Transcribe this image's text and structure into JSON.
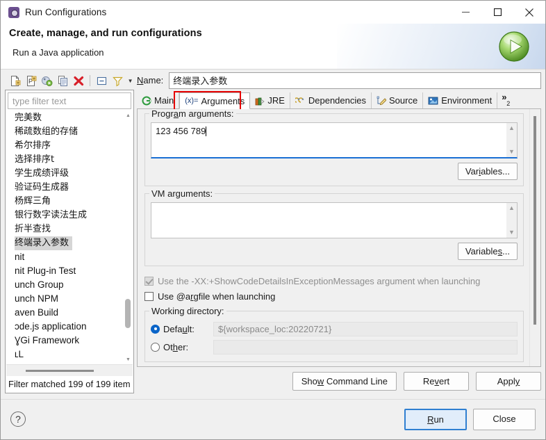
{
  "window": {
    "title": "Run Configurations",
    "icon": "gear-icon",
    "minimize_label": "—",
    "maximize_label": "□",
    "close_label": "✕"
  },
  "header": {
    "title": "Create, manage, and run configurations",
    "subtitle": "Run a Java application",
    "badge_icon": "run-play-icon"
  },
  "left_pane": {
    "toolbar": [
      {
        "name": "new-configuration-icon",
        "tooltip": "New launch configuration"
      },
      {
        "name": "new-prototype-icon",
        "tooltip": "New prototype"
      },
      {
        "name": "export-icon",
        "tooltip": "Export"
      },
      {
        "name": "duplicate-icon",
        "tooltip": "Duplicate"
      },
      {
        "name": "delete-icon",
        "tooltip": "Delete"
      },
      {
        "name": "collapse-all-icon",
        "tooltip": "Collapse All"
      },
      {
        "name": "filter-icon",
        "tooltip": "Filter launch configurations"
      }
    ],
    "filter_placeholder": "type filter text",
    "items": [
      {
        "label": "完美数",
        "cjk": true,
        "selected": false
      },
      {
        "label": "稀疏数组的存储",
        "cjk": true,
        "selected": false
      },
      {
        "label": "希尔排序",
        "cjk": true,
        "selected": false
      },
      {
        "label": "选择排序t",
        "cjk": true,
        "selected": false
      },
      {
        "label": "学生成绩评级",
        "cjk": true,
        "selected": false
      },
      {
        "label": "验证码生成器",
        "cjk": true,
        "selected": false
      },
      {
        "label": "杨辉三角",
        "cjk": true,
        "selected": false
      },
      {
        "label": "银行数字读法生成",
        "cjk": true,
        "selected": false
      },
      {
        "label": "折半查找",
        "cjk": true,
        "selected": false
      },
      {
        "label": "终端录入参数",
        "cjk": true,
        "selected": true
      },
      {
        "label": "nit",
        "cjk": false,
        "selected": false
      },
      {
        "label": "nit Plug-in Test",
        "cjk": false,
        "selected": false
      },
      {
        "label": "unch Group",
        "cjk": false,
        "selected": false
      },
      {
        "label": "unch NPM",
        "cjk": false,
        "selected": false
      },
      {
        "label": "aven Build",
        "cjk": false,
        "selected": false
      },
      {
        "label": "ɔde.js application",
        "cjk": false,
        "selected": false
      },
      {
        "label": "ƔGi Framework",
        "cjk": false,
        "selected": false
      },
      {
        "label": "ʟL",
        "cjk": false,
        "selected": false
      }
    ],
    "status": "Filter matched 199 of 199 item"
  },
  "right_pane": {
    "name_label": "Name:",
    "name_label_mnemonic": "N",
    "name_value": "终端录入参数",
    "tabs": [
      {
        "label": "Main",
        "icon": "main-tab-icon",
        "active": false
      },
      {
        "label": "Arguments",
        "icon": "arguments-tab-icon",
        "active": true,
        "highlighted": true
      },
      {
        "label": "JRE",
        "icon": "jre-tab-icon",
        "active": false
      },
      {
        "label": "Dependencies",
        "icon": "dependencies-tab-icon",
        "active": false
      },
      {
        "label": "Source",
        "icon": "source-tab-icon",
        "active": false
      },
      {
        "label": "Environment",
        "icon": "environment-tab-icon",
        "active": false
      }
    ],
    "tab_overflow": {
      "chevron": "»",
      "count": "2"
    },
    "program_arguments": {
      "legend": "Program arguments:",
      "legend_mnemonic": "a",
      "value": "123 456 789",
      "focused": true,
      "highlighted": true,
      "variables_button": "Variables...",
      "variables_mnemonic": "i"
    },
    "vm_arguments": {
      "legend": "VM arguments:",
      "legend_mnemonic": "g",
      "value": "",
      "variables_button": "Variables...",
      "variables_mnemonic": "s"
    },
    "checkboxes": [
      {
        "label": "Use the -XX:+ShowCodeDetailsInExceptionMessages argument when launching",
        "checked": true,
        "disabled": true,
        "name": "show-code-details-checkbox"
      },
      {
        "label": "Use @argfile when launching",
        "checked": false,
        "disabled": false,
        "name": "use-argfile-checkbox"
      }
    ],
    "working_directory": {
      "legend": "Working directory:",
      "options": [
        {
          "label": "Default:",
          "selected": true,
          "value": "${workspace_loc:20220721}"
        },
        {
          "label": "Other:",
          "selected": false,
          "value": ""
        }
      ]
    },
    "actions": [
      {
        "label": "Show Command Line",
        "name": "show-command-line-button"
      },
      {
        "label": "Revert",
        "name": "revert-button"
      },
      {
        "label": "Apply",
        "name": "apply-button"
      }
    ]
  },
  "footer": {
    "help_icon": "?",
    "buttons": [
      {
        "label": "Run",
        "name": "run-button",
        "primary": true
      },
      {
        "label": "Close",
        "name": "close-button",
        "primary": false
      }
    ]
  },
  "colors": {
    "accent": "#1a6fd4",
    "highlight_box": "#e60000",
    "selection": "#d6d6d6",
    "window_bg": "#f0f0f0"
  }
}
